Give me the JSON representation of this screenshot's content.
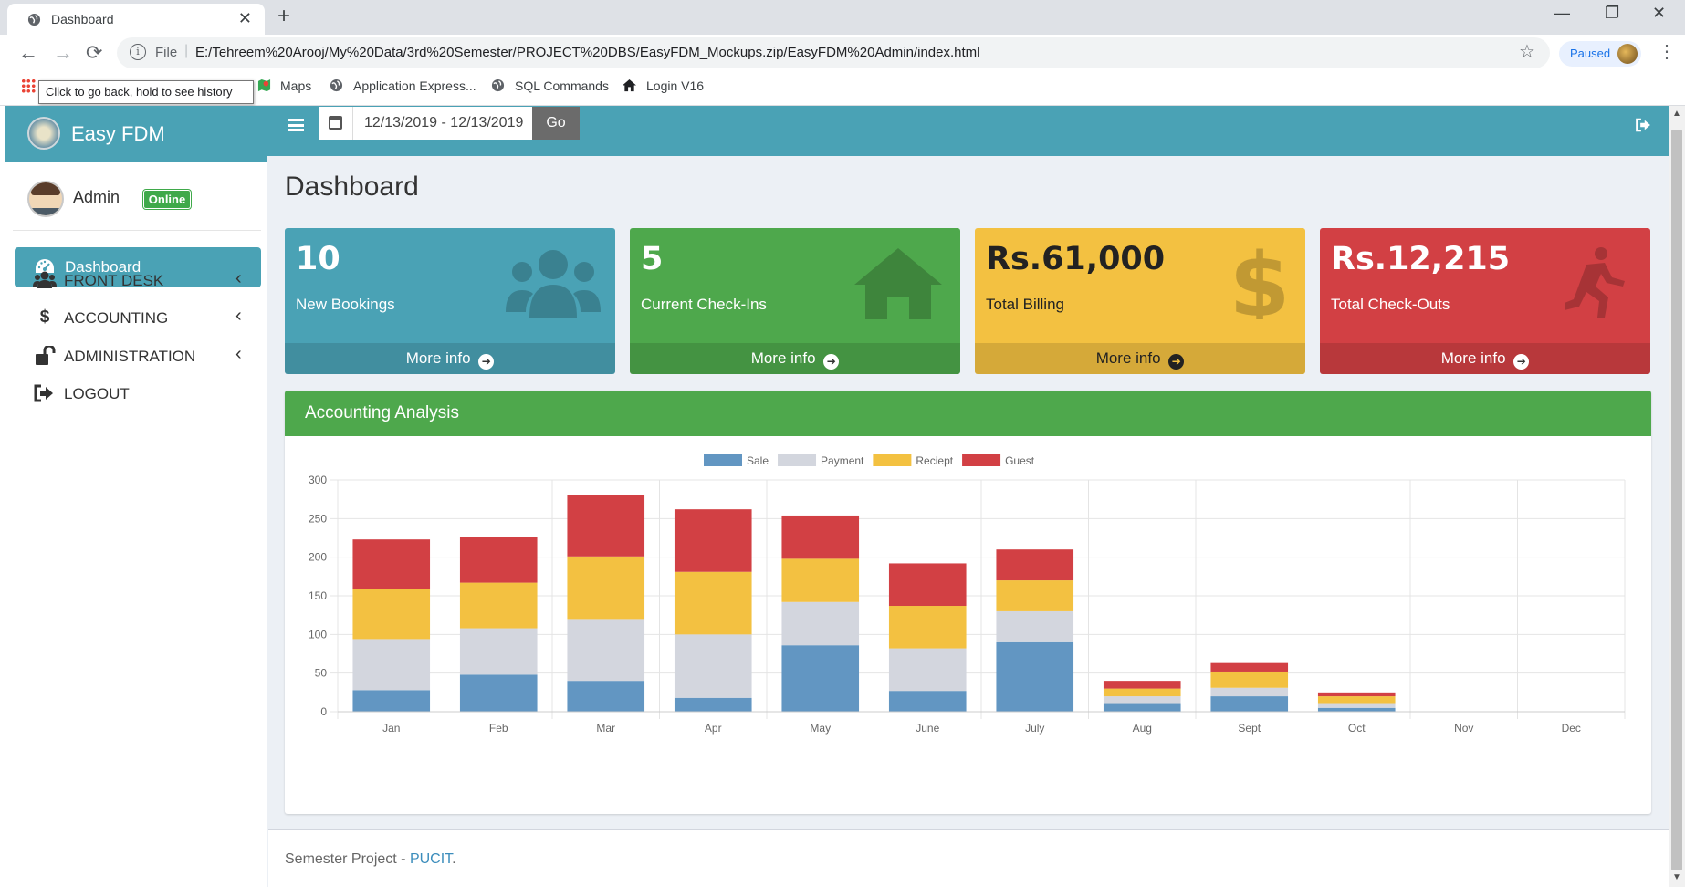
{
  "browser": {
    "tab_title": "Dashboard",
    "tab_close": "✕",
    "new_tab": "+",
    "minimize": "—",
    "restore": "❐",
    "close": "✕",
    "back_icon": "←",
    "forward_icon": "→",
    "reload_icon": "⟳",
    "info_icon": "i",
    "scheme_label": "File",
    "address_separator": "|",
    "url": "E:/Tehreem%20Arooj/My%20Data/3rd%20Semester/PROJECT%20DBS/EasyFDM_Mockups.zip/EasyFDM%20Admin/index.html",
    "star_icon": "☆",
    "profile_label": "Paused",
    "menu_icon": "⋮",
    "tooltip": "Click to go back, hold to see history",
    "bookmarks": [
      {
        "label": "Maps",
        "icon": "maps-icon"
      },
      {
        "label": "Application Express...",
        "icon": "globe-icon"
      },
      {
        "label": "SQL Commands",
        "icon": "globe-icon"
      },
      {
        "label": "Login V16",
        "icon": "home-icon"
      }
    ]
  },
  "app": {
    "brand": "Easy FDM",
    "user": {
      "name": "Admin",
      "status": "Online"
    },
    "sidebar": {
      "items": [
        {
          "label": "Dashboard",
          "icon": "dashboard-icon",
          "active": true
        },
        {
          "label": "FRONT DESK",
          "icon": "users-icon"
        },
        {
          "label": "ACCOUNTING",
          "icon": "dollar-icon"
        },
        {
          "label": "ADMINISTRATION",
          "icon": "unlock-icon"
        },
        {
          "label": "LOGOUT",
          "icon": "sign-out-icon"
        }
      ],
      "chevron": "‹",
      "accounting_glyph": "$"
    },
    "topbar": {
      "date_range": "12/13/2019 - 12/13/2019",
      "go_label": "Go"
    },
    "page_title": "Dashboard",
    "boxes": [
      {
        "value": "10",
        "label": "New Bookings",
        "footer": "More info",
        "color": "#4aa2b5",
        "icon": "users-icon"
      },
      {
        "value": "5",
        "label": "Current Check-Ins",
        "footer": "More info",
        "color": "#4ea84c",
        "icon": "home-icon"
      },
      {
        "value": "Rs.61,000",
        "label": "Total Billing",
        "footer": "More info",
        "color": "#f3c141",
        "icon": "dollar-icon"
      },
      {
        "value": "Rs.12,215",
        "label": "Total Check-Outs",
        "footer": "More info",
        "color": "#d24044",
        "icon": "running-icon"
      }
    ],
    "more_info_arrow": "➔",
    "panel_title": "Accounting Analysis",
    "footer": {
      "text": "Semester Project - ",
      "link": "PUCIT",
      "end": "."
    }
  },
  "chart_data": {
    "type": "bar",
    "stacked": true,
    "categories": [
      "Jan",
      "Feb",
      "Mar",
      "Apr",
      "May",
      "June",
      "July",
      "Aug",
      "Sept",
      "Oct",
      "Nov",
      "Dec"
    ],
    "series": [
      {
        "name": "Sale",
        "color": "#6296c2",
        "values": [
          28,
          48,
          40,
          18,
          86,
          27,
          90,
          10,
          20,
          5,
          0,
          0
        ]
      },
      {
        "name": "Payment",
        "color": "#d3d6de",
        "values": [
          66,
          60,
          80,
          82,
          56,
          55,
          40,
          10,
          11,
          5,
          0,
          0
        ]
      },
      {
        "name": "Reciept",
        "color": "#f3c141",
        "values": [
          65,
          59,
          81,
          81,
          56,
          55,
          40,
          10,
          21,
          10,
          0,
          0
        ]
      },
      {
        "name": "Guest",
        "color": "#d24044",
        "values": [
          64,
          59,
          80,
          81,
          56,
          55,
          40,
          10,
          11,
          5,
          0,
          0
        ]
      }
    ],
    "ylim": [
      0,
      300
    ],
    "yticks": [
      0,
      50,
      100,
      150,
      200,
      250,
      300
    ],
    "legend": "top",
    "grid": true
  },
  "footer_bar_text": ""
}
